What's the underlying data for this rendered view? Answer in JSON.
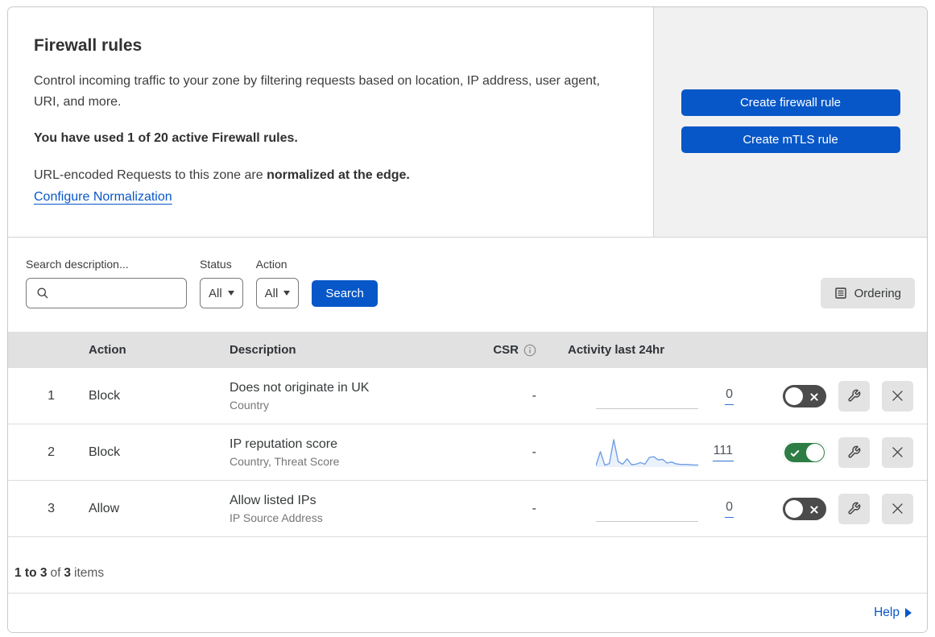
{
  "header": {
    "title": "Firewall rules",
    "description": "Control incoming traffic to your zone by filtering requests based on location, IP address, user agent, URI, and more.",
    "usage_note": "You have used 1 of 20 active Firewall rules.",
    "normalization_prefix": "URL-encoded Requests to this zone are",
    "normalization_bold": "normalized at the edge.",
    "normalization_link": "Configure Normalization"
  },
  "actions_panel": {
    "create_firewall_rule_label": "Create firewall rule",
    "create_mtls_rule_label": "Create mTLS rule"
  },
  "filters": {
    "search_label": "Search description...",
    "search_value": "",
    "status_label": "Status",
    "status_value": "All",
    "action_label": "Action",
    "action_value": "All",
    "search_button_label": "Search",
    "ordering_button_label": "Ordering"
  },
  "table": {
    "headers": {
      "action": "Action",
      "description": "Description",
      "csr": "CSR",
      "activity": "Activity last 24hr"
    },
    "rows": [
      {
        "priority": "1",
        "action": "Block",
        "description": "Does not originate in UK",
        "fields": "Country",
        "csr": "-",
        "activity_count": "0",
        "enabled": false
      },
      {
        "priority": "2",
        "action": "Block",
        "description": "IP reputation score",
        "fields": "Country, Threat Score",
        "csr": "-",
        "activity_count": "111",
        "enabled": true,
        "sparkline": [
          2,
          55,
          4,
          10,
          100,
          18,
          8,
          28,
          6,
          8,
          14,
          8,
          33,
          36,
          24,
          26,
          12,
          16,
          9,
          7,
          7,
          6,
          5,
          5
        ]
      },
      {
        "priority": "3",
        "action": "Allow",
        "description": "Allow listed IPs",
        "fields": "IP Source Address",
        "csr": "-",
        "activity_count": "0",
        "enabled": false
      }
    ]
  },
  "footer": {
    "range": "1 to 3",
    "of_word": "of",
    "total": "3",
    "items_word": "items",
    "help_label": "Help"
  },
  "icons": {
    "search": "magnifier",
    "caret_down": "▾",
    "ordering": "list-document",
    "info": "ⓘ",
    "wrench": "spanner",
    "close": "✕",
    "toggle_check": "✓",
    "toggle_cross": "✕",
    "help_arrow": "▶"
  },
  "colors": {
    "accent_blue": "#0757c8",
    "link_blue": "#0757c8",
    "toggle_on_green": "#2e7d45",
    "toggle_off_gray": "#4b4b4b",
    "sparkline_blue": "#6f9fe6",
    "panel_gray": "#f1f1f1",
    "table_header_gray": "#e1e1e1",
    "control_gray": "#e3e3e3"
  }
}
